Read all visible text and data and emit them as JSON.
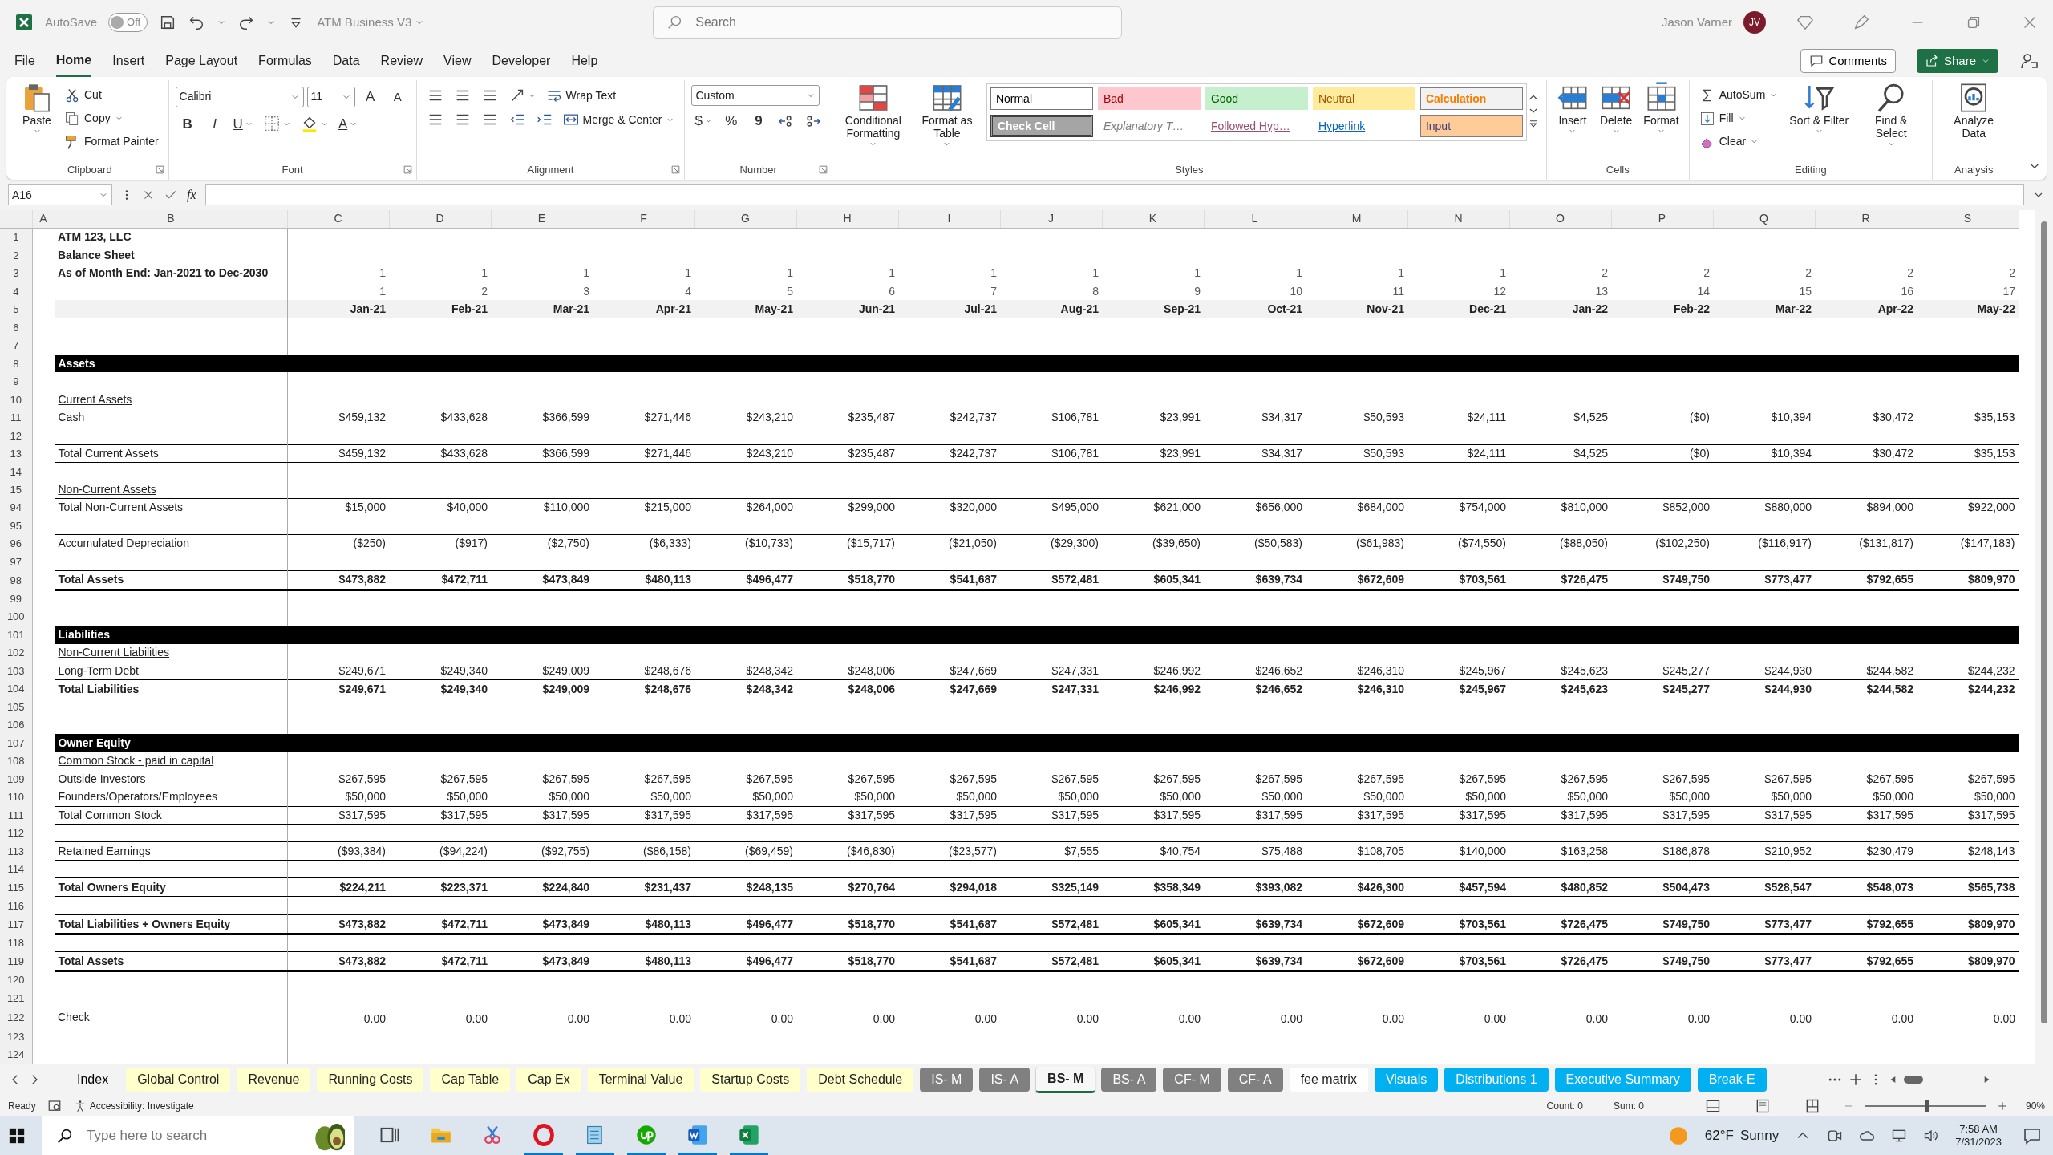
{
  "title_bar": {
    "autosave_label": "AutoSave",
    "autosave": {
      "on": false,
      "label": "Off"
    },
    "document": "ATM Business V3",
    "search": {
      "placeholder": "Search"
    },
    "user": "Jason Varner",
    "avatar": "JV"
  },
  "menu": [
    {
      "label": "File",
      "selected": false
    },
    {
      "label": "Home",
      "selected": true
    },
    {
      "label": "Insert",
      "selected": false
    },
    {
      "label": "Page Layout",
      "selected": false
    },
    {
      "label": "Formulas",
      "selected": false
    },
    {
      "label": "Data",
      "selected": false
    },
    {
      "label": "Review",
      "selected": false
    },
    {
      "label": "View",
      "selected": false
    },
    {
      "label": "Developer",
      "selected": false
    },
    {
      "label": "Help",
      "selected": false
    }
  ],
  "comments": "Comments",
  "share": "Share",
  "ribbon": [
    {
      "label": "Clipboard",
      "items": [
        "Paste",
        "Cut",
        "Copy",
        "Format Painter"
      ]
    },
    {
      "label": "Font",
      "items": [
        "Calibri",
        "11",
        "A",
        "A",
        "B",
        "I",
        "U",
        "A"
      ]
    },
    {
      "label": "Alignment",
      "items": [
        "Wrap Text",
        "Merge & Center"
      ]
    },
    {
      "label": "Number",
      "items": [
        "Custom",
        "$",
        "%",
        "9"
      ]
    },
    {
      "label": "Styles",
      "items": [
        "Conditional Formatting",
        "Format as Table"
      ],
      "styles": [
        {
          "kind": "normal",
          "label": "Normal"
        },
        {
          "kind": "bad",
          "label": "Bad"
        },
        {
          "kind": "good",
          "label": "Good"
        },
        {
          "kind": "neutral",
          "label": "Neutral"
        },
        {
          "kind": "calculation",
          "label": "Calculation"
        },
        {
          "kind": "check",
          "label": "Check Cell"
        },
        {
          "kind": "explanatory",
          "label": "Explanatory T…"
        },
        {
          "kind": "followed",
          "label": "Followed Hyp…"
        },
        {
          "kind": "hyperlink",
          "label": "Hyperlink"
        },
        {
          "kind": "input",
          "label": "Input"
        }
      ]
    },
    {
      "label": "Cells",
      "items": [
        "Insert",
        "Delete",
        "Format"
      ]
    },
    {
      "label": "Editing",
      "items": [
        "AutoSum",
        "Fill",
        "Clear",
        "Sort & Filter",
        "Find & Select"
      ]
    },
    {
      "label": "Analysis",
      "items": [
        "Analyze Data"
      ]
    }
  ],
  "formula_bar": {
    "name_box": "A16",
    "fx": "fx"
  },
  "sheet": {
    "columns": [
      "A",
      "B",
      "C",
      "D",
      "E",
      "F",
      "G",
      "H",
      "I",
      "J",
      "K",
      "L",
      "M",
      "N",
      "O",
      "P",
      "Q",
      "R",
      "S"
    ],
    "rows": [
      {
        "num": "1",
        "kind": "title",
        "label": "ATM 123, LLC"
      },
      {
        "num": "2",
        "kind": "title",
        "label": "Balance Sheet"
      },
      {
        "num": "3",
        "kind": "title",
        "label": "As of Month End: Jan-2021 to Dec-2030",
        "values": [
          "1",
          "1",
          "1",
          "1",
          "1",
          "1",
          "1",
          "1",
          "1",
          "1",
          "1",
          "1",
          "2",
          "2",
          "2",
          "2",
          "2"
        ]
      },
      {
        "num": "4",
        "kind": "index",
        "values": [
          "1",
          "2",
          "3",
          "4",
          "5",
          "6",
          "7",
          "8",
          "9",
          "10",
          "11",
          "12",
          "13",
          "14",
          "15",
          "16",
          "17"
        ]
      },
      {
        "num": "5",
        "kind": "months",
        "values": [
          "Jan-21",
          "Feb-21",
          "Mar-21",
          "Apr-21",
          "May-21",
          "Jun-21",
          "Jul-21",
          "Aug-21",
          "Sep-21",
          "Oct-21",
          "Nov-21",
          "Dec-21",
          "Jan-22",
          "Feb-22",
          "Mar-22",
          "Apr-22",
          "May-22"
        ]
      },
      {
        "num": "6",
        "kind": "empty"
      },
      {
        "num": "7",
        "kind": "empty"
      },
      {
        "num": "8",
        "kind": "band",
        "label": "Assets"
      },
      {
        "num": "9",
        "kind": "inner"
      },
      {
        "num": "10",
        "kind": "subhead",
        "label": "Current Assets"
      },
      {
        "num": "11",
        "kind": "line",
        "label": "Cash",
        "values": [
          "$459,132",
          "$433,628",
          "$366,599",
          "$271,446",
          "$243,210",
          "$235,487",
          "$242,737",
          "$106,781",
          "$23,991",
          "$34,317",
          "$50,593",
          "$24,111",
          "$4,525",
          "($0)",
          "$10,394",
          "$30,472",
          "$35,153"
        ]
      },
      {
        "num": "12",
        "kind": "inner"
      },
      {
        "num": "13",
        "kind": "total",
        "label": "Total Current Assets",
        "values": [
          "$459,132",
          "$433,628",
          "$366,599",
          "$271,446",
          "$243,210",
          "$235,487",
          "$242,737",
          "$106,781",
          "$23,991",
          "$34,317",
          "$50,593",
          "$24,111",
          "$4,525",
          "($0)",
          "$10,394",
          "$30,472",
          "$35,153"
        ]
      },
      {
        "num": "14",
        "kind": "inner"
      },
      {
        "num": "15",
        "kind": "subhead",
        "label": "Non-Current Assets"
      },
      {
        "num": "94",
        "kind": "total",
        "label": "Total Non-Current Assets",
        "values": [
          "$15,000",
          "$40,000",
          "$110,000",
          "$215,000",
          "$264,000",
          "$299,000",
          "$320,000",
          "$495,000",
          "$621,000",
          "$656,000",
          "$684,000",
          "$754,000",
          "$810,000",
          "$852,000",
          "$880,000",
          "$894,000",
          "$922,000"
        ]
      },
      {
        "num": "95",
        "kind": "inner"
      },
      {
        "num": "96",
        "kind": "total",
        "label": "Accumulated Depreciation",
        "values": [
          "($250)",
          "($917)",
          "($2,750)",
          "($6,333)",
          "($10,733)",
          "($15,717)",
          "($21,050)",
          "($29,300)",
          "($39,650)",
          "($50,583)",
          "($61,983)",
          "($74,550)",
          "($88,050)",
          "($102,250)",
          "($116,917)",
          "($131,817)",
          "($147,183)"
        ]
      },
      {
        "num": "97",
        "kind": "inner"
      },
      {
        "num": "98",
        "kind": "grand",
        "label": "Total Assets",
        "values": [
          "$473,882",
          "$472,711",
          "$473,849",
          "$480,113",
          "$496,477",
          "$518,770",
          "$541,687",
          "$572,481",
          "$605,341",
          "$639,734",
          "$672,609",
          "$703,561",
          "$726,475",
          "$749,750",
          "$773,477",
          "$792,655",
          "$809,970"
        ]
      },
      {
        "num": "99",
        "kind": "inner"
      },
      {
        "num": "100",
        "kind": "inner"
      },
      {
        "num": "101",
        "kind": "band",
        "label": "Liabilities"
      },
      {
        "num": "102",
        "kind": "subhead",
        "label": "Non-Current Liabilities"
      },
      {
        "num": "103",
        "kind": "line",
        "label": "Long-Term Debt",
        "values": [
          "$249,671",
          "$249,340",
          "$249,009",
          "$248,676",
          "$248,342",
          "$248,006",
          "$247,669",
          "$247,331",
          "$246,992",
          "$246,652",
          "$246,310",
          "$245,967",
          "$245,623",
          "$245,277",
          "$244,930",
          "$244,582",
          "$244,232"
        ]
      },
      {
        "num": "104",
        "kind": "boldtotal",
        "label": "Total Liabilities",
        "values": [
          "$249,671",
          "$249,340",
          "$249,009",
          "$248,676",
          "$248,342",
          "$248,006",
          "$247,669",
          "$247,331",
          "$246,992",
          "$246,652",
          "$246,310",
          "$245,967",
          "$245,623",
          "$245,277",
          "$244,930",
          "$244,582",
          "$244,232"
        ]
      },
      {
        "num": "105",
        "kind": "inner"
      },
      {
        "num": "106",
        "kind": "inner"
      },
      {
        "num": "107",
        "kind": "band",
        "label": "Owner Equity"
      },
      {
        "num": "108",
        "kind": "subhead",
        "label": "Common Stock - paid in capital"
      },
      {
        "num": "109",
        "kind": "line",
        "label": "Outside Investors",
        "values": [
          "$267,595",
          "$267,595",
          "$267,595",
          "$267,595",
          "$267,595",
          "$267,595",
          "$267,595",
          "$267,595",
          "$267,595",
          "$267,595",
          "$267,595",
          "$267,595",
          "$267,595",
          "$267,595",
          "$267,595",
          "$267,595",
          "$267,595"
        ]
      },
      {
        "num": "110",
        "kind": "line",
        "label": "Founders/Operators/Employees",
        "values": [
          "$50,000",
          "$50,000",
          "$50,000",
          "$50,000",
          "$50,000",
          "$50,000",
          "$50,000",
          "$50,000",
          "$50,000",
          "$50,000",
          "$50,000",
          "$50,000",
          "$50,000",
          "$50,000",
          "$50,000",
          "$50,000",
          "$50,000"
        ]
      },
      {
        "num": "111",
        "kind": "total",
        "label": "Total Common Stock",
        "values": [
          "$317,595",
          "$317,595",
          "$317,595",
          "$317,595",
          "$317,595",
          "$317,595",
          "$317,595",
          "$317,595",
          "$317,595",
          "$317,595",
          "$317,595",
          "$317,595",
          "$317,595",
          "$317,595",
          "$317,595",
          "$317,595",
          "$317,595"
        ]
      },
      {
        "num": "112",
        "kind": "inner"
      },
      {
        "num": "113",
        "kind": "total",
        "label": "Retained Earnings",
        "values": [
          "($93,384)",
          "($94,224)",
          "($92,755)",
          "($86,158)",
          "($69,459)",
          "($46,830)",
          "($23,577)",
          "$7,555",
          "$40,754",
          "$75,488",
          "$108,705",
          "$140,000",
          "$163,258",
          "$186,878",
          "$210,952",
          "$230,479",
          "$248,143"
        ]
      },
      {
        "num": "114",
        "kind": "inner"
      },
      {
        "num": "115",
        "kind": "grand",
        "label": "Total Owners Equity",
        "values": [
          "$224,211",
          "$223,371",
          "$224,840",
          "$231,437",
          "$248,135",
          "$270,764",
          "$294,018",
          "$325,149",
          "$358,349",
          "$393,082",
          "$426,300",
          "$457,594",
          "$480,852",
          "$504,473",
          "$528,547",
          "$548,073",
          "$565,738"
        ]
      },
      {
        "num": "116",
        "kind": "inner"
      },
      {
        "num": "117",
        "kind": "grand",
        "label": "Total Liabilities + Owners Equity",
        "values": [
          "$473,882",
          "$472,711",
          "$473,849",
          "$480,113",
          "$496,477",
          "$518,770",
          "$541,687",
          "$572,481",
          "$605,341",
          "$639,734",
          "$672,609",
          "$703,561",
          "$726,475",
          "$749,750",
          "$773,477",
          "$792,655",
          "$809,970"
        ]
      },
      {
        "num": "118",
        "kind": "inner"
      },
      {
        "num": "119",
        "kind": "grand",
        "label": "Total Assets",
        "values": [
          "$473,882",
          "$472,711",
          "$473,849",
          "$480,113",
          "$496,477",
          "$518,770",
          "$541,687",
          "$572,481",
          "$605,341",
          "$639,734",
          "$672,609",
          "$703,561",
          "$726,475",
          "$749,750",
          "$773,477",
          "$792,655",
          "$809,970"
        ]
      },
      {
        "num": "120",
        "kind": "empty"
      },
      {
        "num": "121",
        "kind": "empty"
      },
      {
        "num": "122",
        "kind": "check",
        "label": "Check",
        "values": [
          "0.00",
          "0.00",
          "0.00",
          "0.00",
          "0.00",
          "0.00",
          "0.00",
          "0.00",
          "0.00",
          "0.00",
          "0.00",
          "0.00",
          "0.00",
          "0.00",
          "0.00",
          "0.00",
          "0.00"
        ]
      },
      {
        "num": "123",
        "kind": "empty"
      },
      {
        "num": "124",
        "kind": "empty"
      }
    ]
  },
  "sheet_tabs": [
    {
      "label": "Index",
      "selected": false
    },
    {
      "label": "Global Control",
      "color": "#ffffcc",
      "selected": false
    },
    {
      "label": "Revenue",
      "color": "#ffffcc",
      "selected": false
    },
    {
      "label": "Running Costs",
      "color": "#ffffcc",
      "selected": false
    },
    {
      "label": "Cap Table",
      "color": "#ffffcc",
      "selected": false
    },
    {
      "label": "Cap Ex",
      "color": "#ffffcc",
      "selected": false
    },
    {
      "label": "Terminal Value",
      "color": "#ffffcc",
      "selected": false
    },
    {
      "label": "Startup Costs",
      "color": "#ffffcc",
      "selected": false
    },
    {
      "label": "Debt Schedule",
      "color": "#ffffcc",
      "selected": false
    },
    {
      "label": "IS- M",
      "color": "#808080",
      "selected": false
    },
    {
      "label": "IS- A",
      "color": "#808080",
      "selected": false
    },
    {
      "label": "BS- M",
      "selected": true
    },
    {
      "label": "BS- A",
      "color": "#808080",
      "selected": false
    },
    {
      "label": "CF- M",
      "color": "#808080",
      "selected": false
    },
    {
      "label": "CF- A",
      "color": "#808080",
      "selected": false
    },
    {
      "label": "fee matrix",
      "color": "#ffffff",
      "selected": false
    },
    {
      "label": "Visuals",
      "color": "#00b0f0",
      "selected": false
    },
    {
      "label": "Distributions 1",
      "color": "#00b0f0",
      "selected": false
    },
    {
      "label": "Executive Summary",
      "color": "#00b0f0",
      "selected": false
    },
    {
      "label": "Break-E",
      "color": "#00b0f0",
      "selected": false
    }
  ],
  "status_bar": {
    "mode": "Ready",
    "accessibility": "Accessibility: Investigate",
    "count": "Count: 0",
    "sum": "Sum: 0",
    "zoom": {
      "level": 0.5,
      "reading": "90%"
    }
  },
  "taskbar": {
    "search": {
      "placeholder": "Type here to search"
    },
    "apps": [
      {
        "kind": "taskview",
        "running": false
      },
      {
        "kind": "folder",
        "running": false
      },
      {
        "kind": "snip",
        "running": false
      },
      {
        "kind": "opera",
        "running": true
      },
      {
        "kind": "notepad",
        "running": true
      },
      {
        "kind": "upwork",
        "running": true
      },
      {
        "kind": "word",
        "running": true
      },
      {
        "kind": "excel",
        "running": true
      }
    ],
    "weather": {
      "temp": "62°F",
      "condition": "Sunny"
    },
    "time": "7:58 AM",
    "date": "7/31/2023"
  }
}
